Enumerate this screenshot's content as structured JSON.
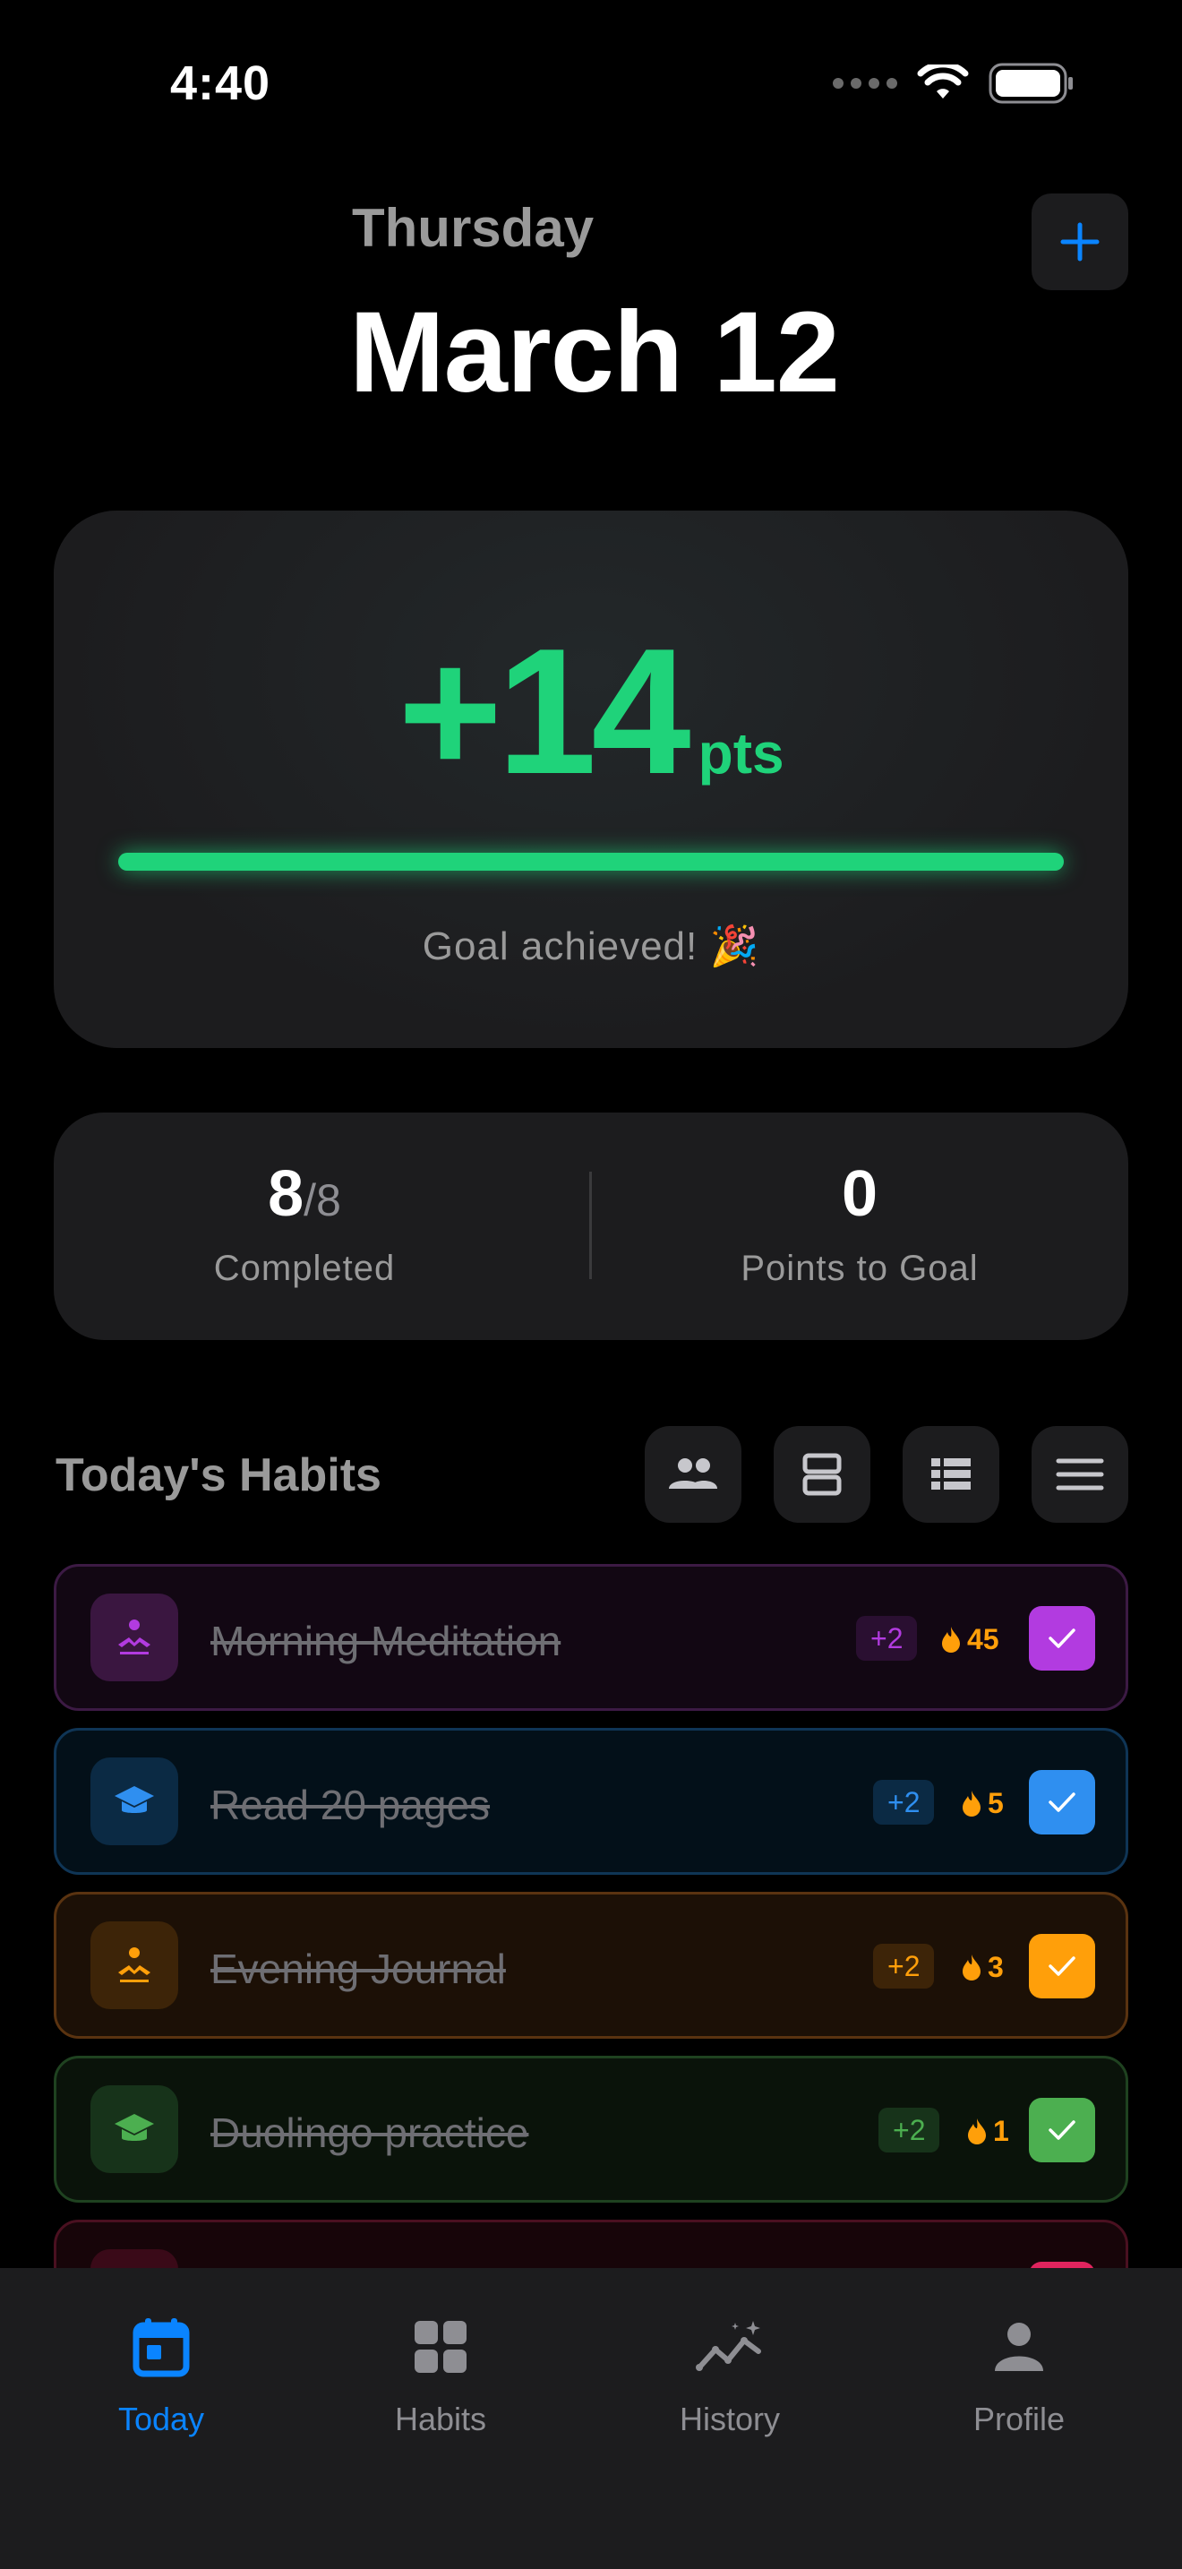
{
  "status_bar": {
    "time": "4:40"
  },
  "header": {
    "day": "Thursday",
    "date": "March 12"
  },
  "points_card": {
    "value": "+14",
    "unit": "pts",
    "progress_fraction": 1.0,
    "message": "Goal achieved! 🎉"
  },
  "stats": {
    "completed_value": "8",
    "completed_total": "/8",
    "completed_label": "Completed",
    "points_to_goal_value": "0",
    "points_to_goal_label": "Points to Goal"
  },
  "habits_section": {
    "title": "Today's Habits",
    "view_buttons": [
      "people-icon",
      "card-view-icon",
      "list-view-icon",
      "menu-icon"
    ]
  },
  "habits": [
    {
      "name": "Morning Meditation",
      "points": "+2",
      "streak": "45",
      "icon": "meditation-icon",
      "color": "#b23be0",
      "completed": true
    },
    {
      "name": "Read 20 pages",
      "points": "+2",
      "streak": "5",
      "icon": "graduation-cap-icon",
      "color": "#2f8ff0",
      "completed": true
    },
    {
      "name": "Evening Journal",
      "points": "+2",
      "streak": "3",
      "icon": "meditation-icon",
      "color": "#ff9f0a",
      "completed": true
    },
    {
      "name": "Duolingo practice",
      "points": "+2",
      "streak": "1",
      "icon": "graduation-cap-icon",
      "color": "#4caf50",
      "completed": true
    }
  ],
  "tab_bar": {
    "tabs": [
      {
        "label": "Today",
        "icon": "calendar-icon",
        "active": true
      },
      {
        "label": "Habits",
        "icon": "grid-icon",
        "active": false
      },
      {
        "label": "History",
        "icon": "chart-sparkle-icon",
        "active": false
      },
      {
        "label": "Profile",
        "icon": "person-icon",
        "active": false
      }
    ]
  },
  "colors": {
    "accent": "#0a84ff",
    "success": "#1fd37a",
    "streak": "#ff9f0a",
    "card": "#1c1c1e"
  }
}
